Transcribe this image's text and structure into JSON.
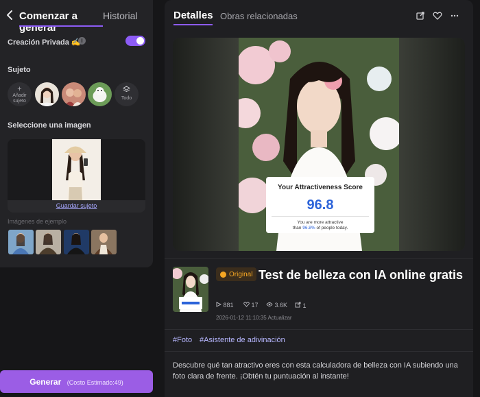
{
  "left": {
    "tab_generate": "Comenzar a generar",
    "tab_history": "Historial",
    "private_creation": "Creación Privada ✍",
    "private_toggle_on": true,
    "subject_section": "Sujeto",
    "add_subject": "Añadir sujeto",
    "all_label": "Todo",
    "select_image_section": "Seleccione una imagen",
    "save_subject": "Guardar sujeto",
    "example_images_label": "Imágenes de ejemplo",
    "generate_button": "Generar",
    "generate_cost": "(Costo Estimado:49)"
  },
  "right": {
    "tab_details": "Detalles",
    "tab_related": "Obras relacionadas",
    "score_card": {
      "title": "Your Attractiveness Score",
      "value": "96.8",
      "sub_prefix": "You are more attractive",
      "sub_than": "than",
      "sub_pct": "96.8%",
      "sub_suffix": "of people today."
    },
    "badge": "Original",
    "title": "Test de belleza con IA online gratis",
    "stats": {
      "plays": "881",
      "likes": "17",
      "views": "3.6K",
      "shares": "1"
    },
    "meta": "2026-01-12 11:10:35 Actualizar",
    "tags": [
      "#Foto",
      "#Asistente de adivinación"
    ],
    "description": "Descubre qué tan atractivo eres con esta calculadora de belleza con IA subiendo una foto clara de frente. ¡Obtén tu puntuación al instante!"
  },
  "icons": {
    "back": "chevron-left-icon",
    "info": "info-icon",
    "layers": "layers-icon",
    "external": "external-link-icon",
    "heart": "heart-icon",
    "more": "more-dots-icon",
    "play": "play-icon",
    "eye": "eye-icon",
    "share": "share-icon"
  },
  "colors": {
    "accent": "#8d5cf6",
    "generate": "#9b5de5",
    "badge": "#f5a623",
    "score": "#2b63d9",
    "tags": "#b7b7ff"
  }
}
